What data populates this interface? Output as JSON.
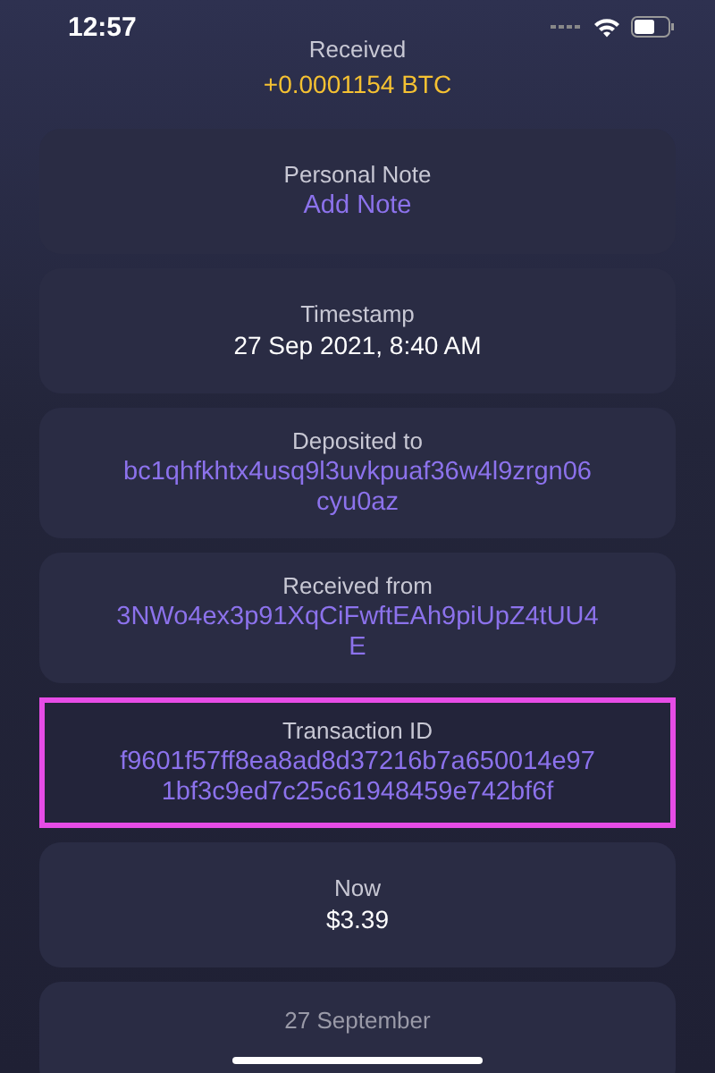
{
  "status_bar": {
    "time": "12:57"
  },
  "header": {
    "label": "Received",
    "amount": "+0.0001154 BTC"
  },
  "cards": [
    {
      "label": "Personal Note",
      "kind": "link",
      "lines": [
        "Add Note"
      ],
      "highlighted": false
    },
    {
      "label": "Timestamp",
      "kind": "plain",
      "lines": [
        "27 Sep 2021, 8:40 AM"
      ],
      "highlighted": false
    },
    {
      "label": "Deposited to",
      "kind": "link",
      "lines": [
        "bc1qhfkhtx4usq9l3uvkpuaf36w4l9zrgn06",
        "cyu0az"
      ],
      "highlighted": false
    },
    {
      "label": "Received from",
      "kind": "link",
      "lines": [
        "3NWo4ex3p91XqCiFwftEAh9piUpZ4tUU4",
        "E"
      ],
      "highlighted": false
    },
    {
      "label": "Transaction ID",
      "kind": "link",
      "lines": [
        "f9601f57ff8ea8ad8d37216b7a650014e97",
        "1bf3c9ed7c25c61948459e742bf6f"
      ],
      "highlighted": true
    },
    {
      "label": "Now",
      "kind": "plain",
      "lines": [
        "$3.39"
      ],
      "highlighted": false
    }
  ],
  "footer_card": {
    "label": "27 September"
  }
}
